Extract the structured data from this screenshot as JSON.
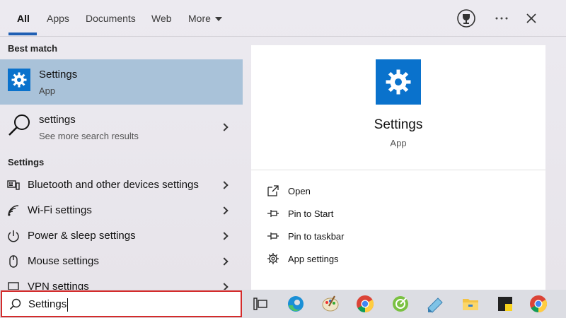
{
  "tabs": [
    {
      "label": "All"
    },
    {
      "label": "Apps"
    },
    {
      "label": "Documents"
    },
    {
      "label": "Web"
    },
    {
      "label": "More"
    }
  ],
  "top_icons": [
    "trophy-icon",
    "more-options-icon",
    "close-icon"
  ],
  "left": {
    "best_match_heading": "Best match",
    "best_match": {
      "title": "Settings",
      "subtitle": "App",
      "icon": "gear-icon"
    },
    "web_result": {
      "title": "settings",
      "subtitle": "See more search results",
      "icon": "search-icon"
    },
    "settings_heading": "Settings",
    "settings_items": [
      {
        "label": "Bluetooth and other devices settings",
        "icon": "devices-icon"
      },
      {
        "label": "Wi-Fi settings",
        "icon": "wifi-icon"
      },
      {
        "label": "Power & sleep settings",
        "icon": "power-icon"
      },
      {
        "label": "Mouse settings",
        "icon": "mouse-icon"
      },
      {
        "label": "VPN settings",
        "icon": "vpn-icon"
      }
    ]
  },
  "right": {
    "app_title": "Settings",
    "app_subtitle": "App",
    "actions": [
      {
        "label": "Open",
        "icon": "open-icon"
      },
      {
        "label": "Pin to Start",
        "icon": "pin-icon"
      },
      {
        "label": "Pin to taskbar",
        "icon": "pin-icon"
      },
      {
        "label": "App settings",
        "icon": "gear-icon"
      }
    ]
  },
  "search": {
    "value": "Settings",
    "icon": "search-icon"
  },
  "taskbar": {
    "icons": [
      "task-view-icon",
      "edge-icon",
      "paint-icon",
      "chrome-icon",
      "greenshot-icon",
      "notepad-icon",
      "file-explorer-icon",
      "sticky-notes-icon",
      "chrome-icon"
    ]
  },
  "colors": {
    "accent": "#0a72cc",
    "highlight": "#a9c2d9",
    "search_border": "#d42b2b",
    "tab_underline": "#1f5fb3"
  }
}
